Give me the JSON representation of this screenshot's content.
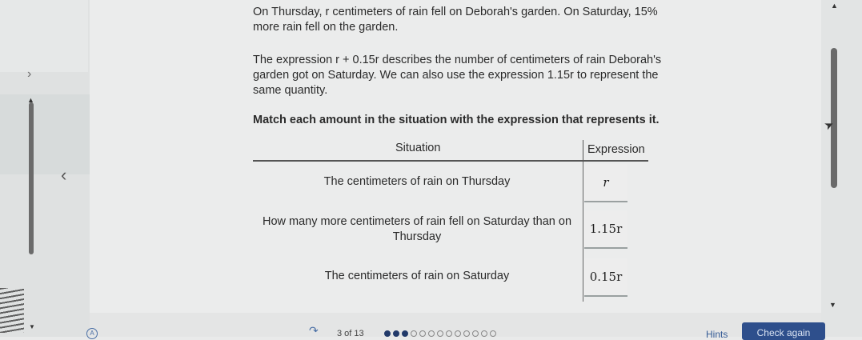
{
  "problem": {
    "para1": "On Thursday, r centimeters of rain fell on Deborah's garden. On Saturday, 15% more rain fell on the garden.",
    "para2": "The expression r + 0.15r describes the number of centimeters of rain Deborah's garden got on Saturday. We can also use the expression 1.15r to represent the same quantity.",
    "instruction": "Match each amount in the situation with the expression that represents it."
  },
  "table": {
    "header_situation": "Situation",
    "header_expression": "Expression",
    "rows": [
      {
        "situation": "The centimeters of rain on Thursday",
        "expression": "r"
      },
      {
        "situation": "How many more centimeters of rain fell on Saturday than on Thursday",
        "expression": "1.15r"
      },
      {
        "situation": "The centimeters of rain on Saturday",
        "expression": "0.15r"
      }
    ]
  },
  "footer": {
    "progress_label": "3 of 13",
    "progress_total": 13,
    "progress_current": 3,
    "hints_label": "Hints",
    "check_label": "Check again"
  },
  "colors": {
    "accent": "#2e4f8c",
    "link": "#355c97",
    "background": "#ebecec"
  }
}
